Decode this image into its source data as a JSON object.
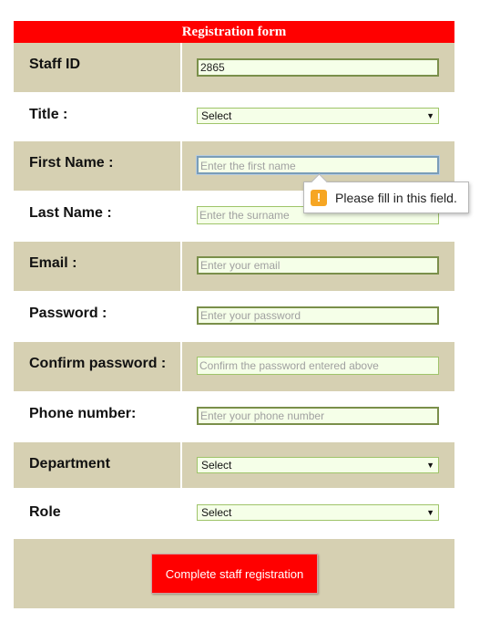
{
  "form": {
    "title": "Registration form",
    "fields": {
      "staff_id": {
        "label": "Staff ID",
        "value": "2865"
      },
      "title": {
        "label": "Title :",
        "selected": "Select"
      },
      "first_name": {
        "label": "First Name :",
        "placeholder": "Enter the first name"
      },
      "last_name": {
        "label": "Last Name :",
        "placeholder": "Enter the surname"
      },
      "email": {
        "label": "Email :",
        "placeholder": "Enter your email"
      },
      "password": {
        "label": "Password :",
        "placeholder": "Enter your password"
      },
      "confirm_password": {
        "label": "Confirm password :",
        "placeholder": "Confirm the password entered above"
      },
      "phone": {
        "label": "Phone number:",
        "placeholder": "Enter your phone number"
      },
      "department": {
        "label": "Department",
        "selected": "Select"
      },
      "role": {
        "label": "Role",
        "selected": "Select"
      }
    },
    "submit_label": "Complete staff registration"
  },
  "tooltip": {
    "icon": "warning-icon",
    "text": "Please fill in this field."
  },
  "colors": {
    "header": "#ff0000",
    "shaded_row": "#d6d0b2",
    "input_bg": "#f5ffe8",
    "button": "#ff0000"
  }
}
